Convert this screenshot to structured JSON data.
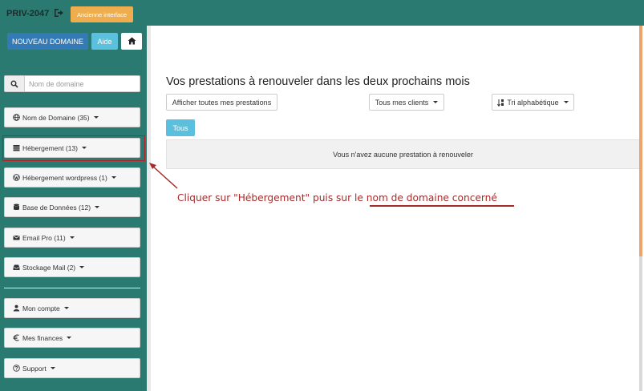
{
  "header": {
    "account_code": "PRIV-2047",
    "old_interface_label": "Ancienne interface"
  },
  "sidebar": {
    "new_domain_label": "NOUVEAU DOMAINE",
    "help_label": "Aide",
    "search_placeholder": "Nom de domaine",
    "items": [
      {
        "label": "Nom de Domaine (35)",
        "icon": "globe-icon"
      },
      {
        "label": "Hébergement (13)",
        "icon": "server-icon"
      },
      {
        "label": "Hébergement wordpress (1)",
        "icon": "wordpress-icon"
      },
      {
        "label": "Base de Données (12)",
        "icon": "database-icon"
      },
      {
        "label": "Email Pro (11)",
        "icon": "envelope-icon"
      },
      {
        "label": "Stockage Mail (2)",
        "icon": "inbox-icon"
      }
    ],
    "account_items": [
      {
        "label": "Mon compte",
        "icon": "user-icon"
      },
      {
        "label": "Mes finances",
        "icon": "euro-icon"
      },
      {
        "label": "Support",
        "icon": "question-circle-icon"
      }
    ]
  },
  "main": {
    "title": "Vos prestations à renouveler dans les deux prochains mois",
    "show_all_label": "Afficher toutes mes prestations",
    "clients_label": "Tous mes clients",
    "sort_label": "Tri alphabétique",
    "filter_all_label": "Tous",
    "empty_message": "Vous n'avez aucune prestation à renouveler"
  },
  "annotation": {
    "text": "Cliquer sur \"Hébergement\" puis sur le nom de domaine concerné",
    "color": "#a52a2a"
  },
  "colors": {
    "sidebar": "#2a7a72",
    "primary": "#337ab7",
    "info": "#5bc0de",
    "warning": "#f0ad4e"
  }
}
